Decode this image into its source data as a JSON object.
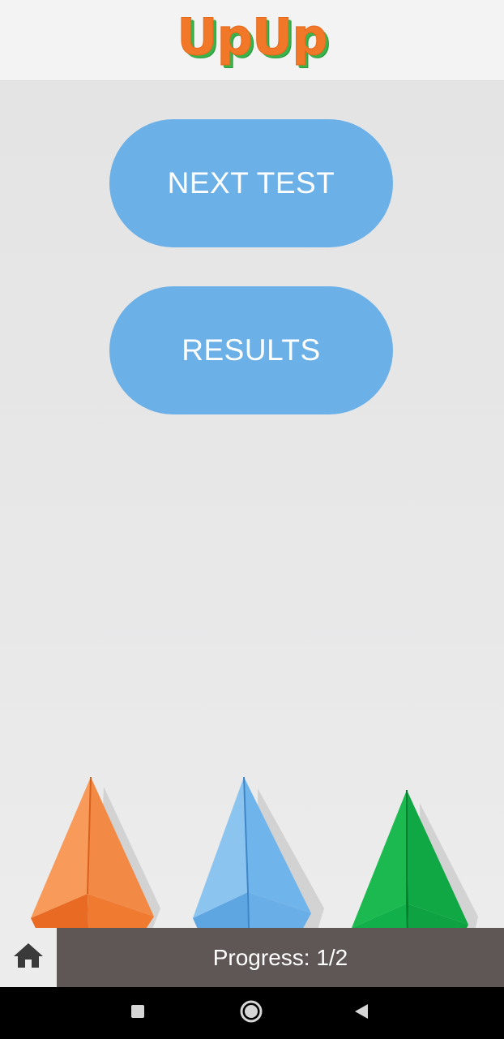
{
  "app": {
    "logo_text": "UpUp"
  },
  "buttons": {
    "next_test": "NEXT TEST",
    "results": "RESULTS"
  },
  "footer": {
    "progress_text": "Progress: 1/2"
  },
  "icons": {
    "home": "home-icon",
    "recents": "square-icon",
    "home_nav": "circle-icon",
    "back": "back-triangle-icon"
  },
  "colors": {
    "accent_button": "#6cb0e8",
    "logo_orange": "#f07828",
    "logo_green": "#39b44a",
    "progress_bg": "#5e5756",
    "rocket_orange": "#f28a45",
    "rocket_blue": "#6fb4ea",
    "rocket_green": "#12b04a",
    "flame": "#ffcc1a"
  }
}
